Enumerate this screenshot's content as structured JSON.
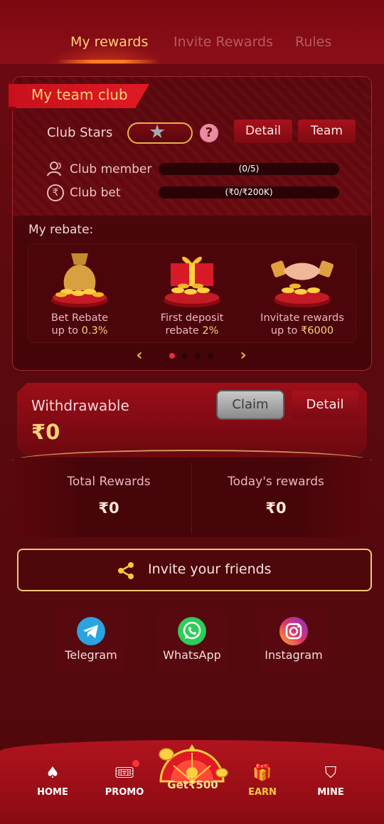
{
  "tabs": [
    "My rewards",
    "Invite Rewards",
    "Rules"
  ],
  "club": {
    "title": "My team club",
    "stars_label": "Club Stars",
    "help": "?",
    "detail_btn": "Detail",
    "team_btn": "Team",
    "member_label": "Club member",
    "member_progress": "(0/5)",
    "bet_label": "Club bet",
    "bet_progress": "(₹0/₹200K)",
    "member_progress_fraction": 0,
    "bet_progress_fraction": 0
  },
  "rebate": {
    "title": "My rebate:",
    "items": [
      {
        "line1": "Bet Rebate",
        "line2_prefix": "up to ",
        "line2_value": "0.3%"
      },
      {
        "line1": "First deposit",
        "line2_prefix": "rebate ",
        "line2_value": "2%"
      },
      {
        "line1": "Invitate rewards",
        "line2_prefix": "up to ",
        "line2_value": "₹6000"
      }
    ],
    "page_count": 4,
    "active_page": 1
  },
  "withdraw": {
    "label": "Withdrawable",
    "amount": "₹0",
    "claim_btn": "Claim",
    "detail_btn": "Detail"
  },
  "rewards": {
    "total_label": "Total Rewards",
    "total_value": "₹0",
    "today_label": "Today's rewards",
    "today_value": "₹0"
  },
  "invite": {
    "label": "Invite your friends"
  },
  "social": [
    {
      "label": "Telegram",
      "icon": "telegram-icon",
      "color": "#2aa3e0"
    },
    {
      "label": "WhatsApp",
      "icon": "whatsapp-icon",
      "color": "#2ecc5a"
    },
    {
      "label": "Instagram",
      "icon": "instagram-icon",
      "color": "#d6307a"
    }
  ],
  "nav": {
    "home": "HOME",
    "promo": "PROMO",
    "get": "Get₹500",
    "earn": "EARN",
    "mine": "MINE"
  },
  "colors": {
    "accent_gold": "#ffd27a",
    "primary_red": "#a8111c",
    "background": "#5c0a0e"
  }
}
